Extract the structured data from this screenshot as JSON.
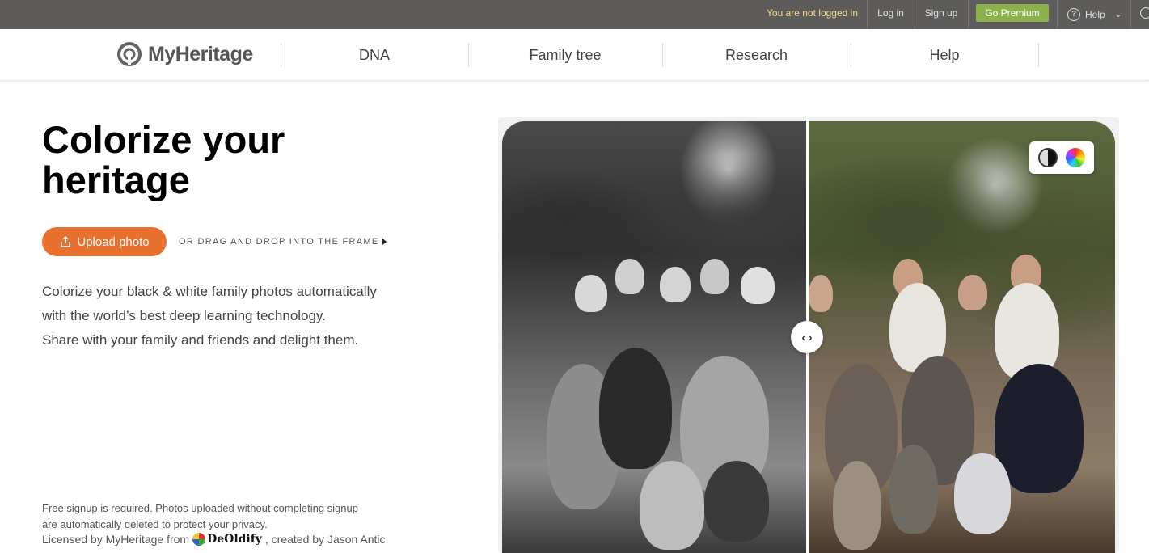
{
  "topbar": {
    "status": "You are not logged in",
    "login": "Log in",
    "signup": "Sign up",
    "premium": "Go Premium",
    "help": "Help"
  },
  "nav": {
    "logo": "MyHeritage",
    "items": [
      "DNA",
      "Family tree",
      "Research",
      "Help"
    ]
  },
  "hero": {
    "headline_line1": "Colorize your",
    "headline_line2": "heritage",
    "upload_label": "Upload photo",
    "drag_text": "OR DRAG AND DROP INTO THE FRAME",
    "desc_line1": "Colorize your black & white family photos automatically",
    "desc_line2": "with the world’s best deep learning technology.",
    "desc_line3": "Share with your family and friends and delight them.",
    "fine_line1": "Free signup is required. Photos uploaded without completing signup",
    "fine_line2": "are automatically deleted to protect your privacy.",
    "license_prefix": "Licensed by MyHeritage from",
    "license_brand": "DeOldify",
    "license_suffix": ", created by Jason Antic"
  },
  "icons": [
    "upload-icon",
    "help-icon",
    "chevron-down-icon",
    "globe-icon",
    "compare-handle-icon",
    "black-white-icon",
    "color-wheel-icon"
  ],
  "colors": {
    "accent": "#e8712f",
    "premium": "#8bb14c",
    "topbar": "#5d5c5a"
  }
}
